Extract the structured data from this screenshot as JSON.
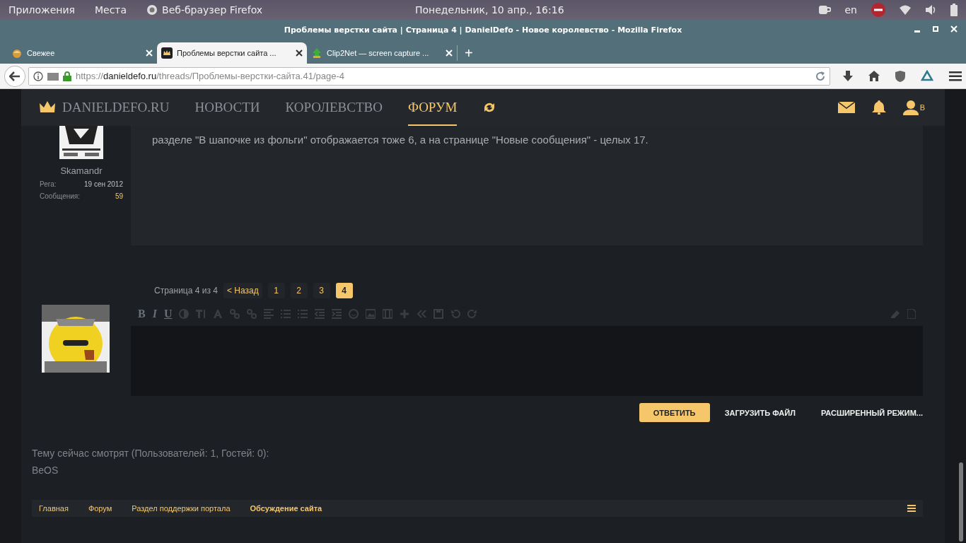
{
  "system_bar": {
    "menus": [
      "Приложения",
      "Места"
    ],
    "app": "Веб-браузер Firefox",
    "clock": "Понедельник, 10 апр., 16:16",
    "language": "en"
  },
  "window": {
    "title": "Проблемы верстки сайта | Страница 4 | DanielDefo - Новое королевство - Mozilla Firefox"
  },
  "tabs": [
    {
      "label": "Свежее",
      "selected": false
    },
    {
      "label": "Проблемы верстки сайта ...",
      "selected": true
    },
    {
      "label": "Clip2Net — screen capture ...",
      "selected": false
    }
  ],
  "new_tab": "+",
  "address": {
    "scheme": "https://",
    "host": "danieldefo.ru",
    "path": "/threads/Проблемы-верстки-сайта.41/page-4"
  },
  "site_nav": {
    "logo": "DANIELDEFO.RU",
    "items": [
      {
        "label": "НОВОСТИ",
        "selected": false
      },
      {
        "label": "КОРОЛЕВСТВО",
        "selected": false
      },
      {
        "label": "ФОРУМ",
        "selected": true
      }
    ],
    "user_letter": "В"
  },
  "post": {
    "author": "Skamandr",
    "stats": [
      {
        "label": "Рега:",
        "value": "19 сен 2012"
      },
      {
        "label": "Сообщения:",
        "value": "59"
      }
    ],
    "text": "разделе \"В шапочке из фольги\" отображается тоже 6, а на странице \"Новые сообщения\" - целых 17."
  },
  "pagination": {
    "summary": "Страница 4 из 4",
    "prev": "< Назад",
    "pages": [
      {
        "label": "1",
        "selected": false
      },
      {
        "label": "2",
        "selected": false
      },
      {
        "label": "3",
        "selected": false
      },
      {
        "label": "4",
        "selected": true
      }
    ]
  },
  "editor": {
    "text_tools": [
      "B",
      "I",
      "U"
    ]
  },
  "reply_buttons": [
    {
      "label": "ОТВЕТИТЬ",
      "kind": "primary"
    },
    {
      "label": "ЗАГРУЗИТЬ ФАЙЛ",
      "kind": "plain"
    },
    {
      "label": "РАСШИРЕННЫЙ РЕЖИМ...",
      "kind": "plain"
    }
  ],
  "viewers": {
    "heading": "Тему сейчас смотрят (Пользователей: 1, Гостей: 0):",
    "users": "BeOS"
  },
  "breadcrumb": [
    {
      "label": "Главная",
      "current": false
    },
    {
      "label": "Форум",
      "current": false
    },
    {
      "label": "Раздел поддержки портала",
      "current": false
    },
    {
      "label": "Обсуждение сайта",
      "current": true
    }
  ]
}
